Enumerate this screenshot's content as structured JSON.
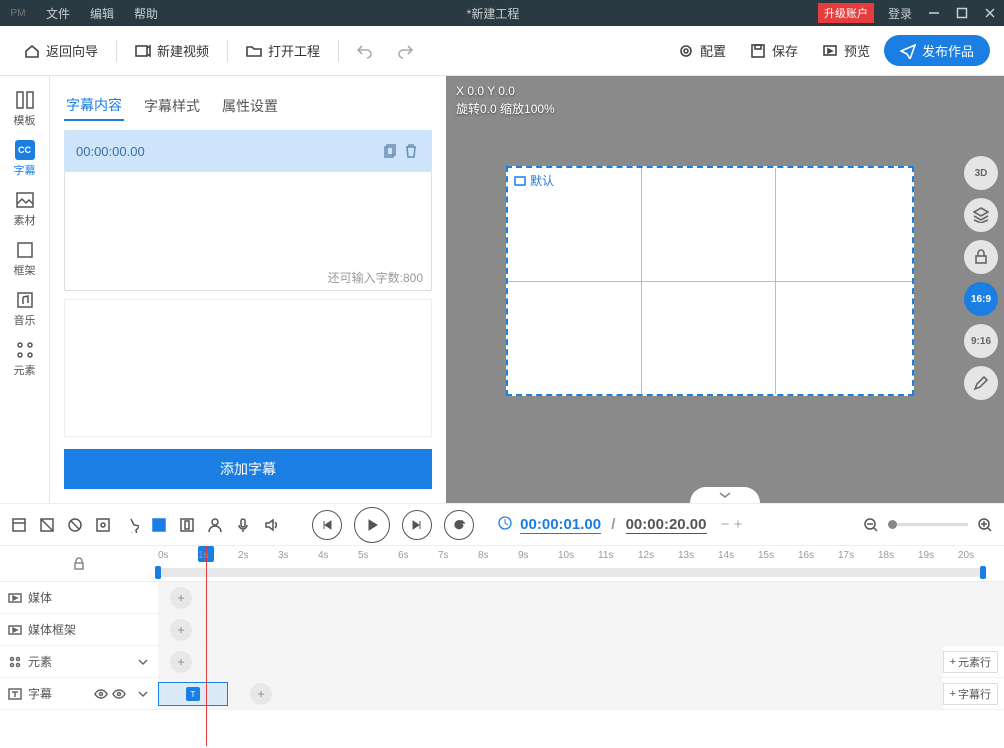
{
  "titlebar": {
    "logo": "PM",
    "menus": [
      "文件",
      "编辑",
      "帮助"
    ],
    "title": "*新建工程",
    "upgrade": "升级账户",
    "login": "登录"
  },
  "toolbar": {
    "back": "返回向导",
    "newvideo": "新建视频",
    "open": "打开工程",
    "config": "配置",
    "save": "保存",
    "preview": "预览",
    "publish": "发布作品"
  },
  "sidebar": {
    "items": [
      {
        "key": "template",
        "label": "模板"
      },
      {
        "key": "subtitle",
        "label": "字幕",
        "active": true,
        "cc": "CC"
      },
      {
        "key": "material",
        "label": "素材"
      },
      {
        "key": "frame",
        "label": "框架"
      },
      {
        "key": "music",
        "label": "音乐"
      },
      {
        "key": "element",
        "label": "元素"
      }
    ]
  },
  "panel": {
    "tabs": [
      "字幕内容",
      "字幕样式",
      "属性设置"
    ],
    "active": 0,
    "time": "00:00:00.00",
    "counter": "还可输入字数:800",
    "addbtn": "添加字幕"
  },
  "canvas": {
    "coord": "X 0.0  Y 0.0",
    "rotzoom": "旋转0.0 缩放100%",
    "default_label": "默认",
    "tools": [
      {
        "k": "3d",
        "t": "3D"
      },
      {
        "k": "layers",
        "t": ""
      },
      {
        "k": "lock",
        "t": ""
      },
      {
        "k": "169",
        "t": "16:9",
        "active": true
      },
      {
        "k": "916",
        "t": "9:16"
      },
      {
        "k": "edit",
        "t": ""
      }
    ]
  },
  "playbar": {
    "current": "00:00:01.00",
    "total": "00:00:20.00"
  },
  "timeline": {
    "ticks": [
      "0s",
      "1s",
      "2s",
      "3s",
      "4s",
      "5s",
      "6s",
      "7s",
      "8s",
      "9s",
      "10s",
      "11s",
      "12s",
      "13s",
      "14s",
      "15s",
      "16s",
      "17s",
      "18s",
      "19s",
      "20s"
    ],
    "tracks": [
      {
        "key": "media",
        "label": "媒体",
        "plus": true
      },
      {
        "key": "mediaframe",
        "label": "媒体框架",
        "plus": true
      },
      {
        "key": "element",
        "label": "元素",
        "plus": true,
        "chevron": true,
        "addrow": "元素行"
      },
      {
        "key": "subtitle",
        "label": "字幕",
        "eyes": true,
        "chevron": true,
        "addrow": "字幕行",
        "clip": true
      }
    ]
  }
}
